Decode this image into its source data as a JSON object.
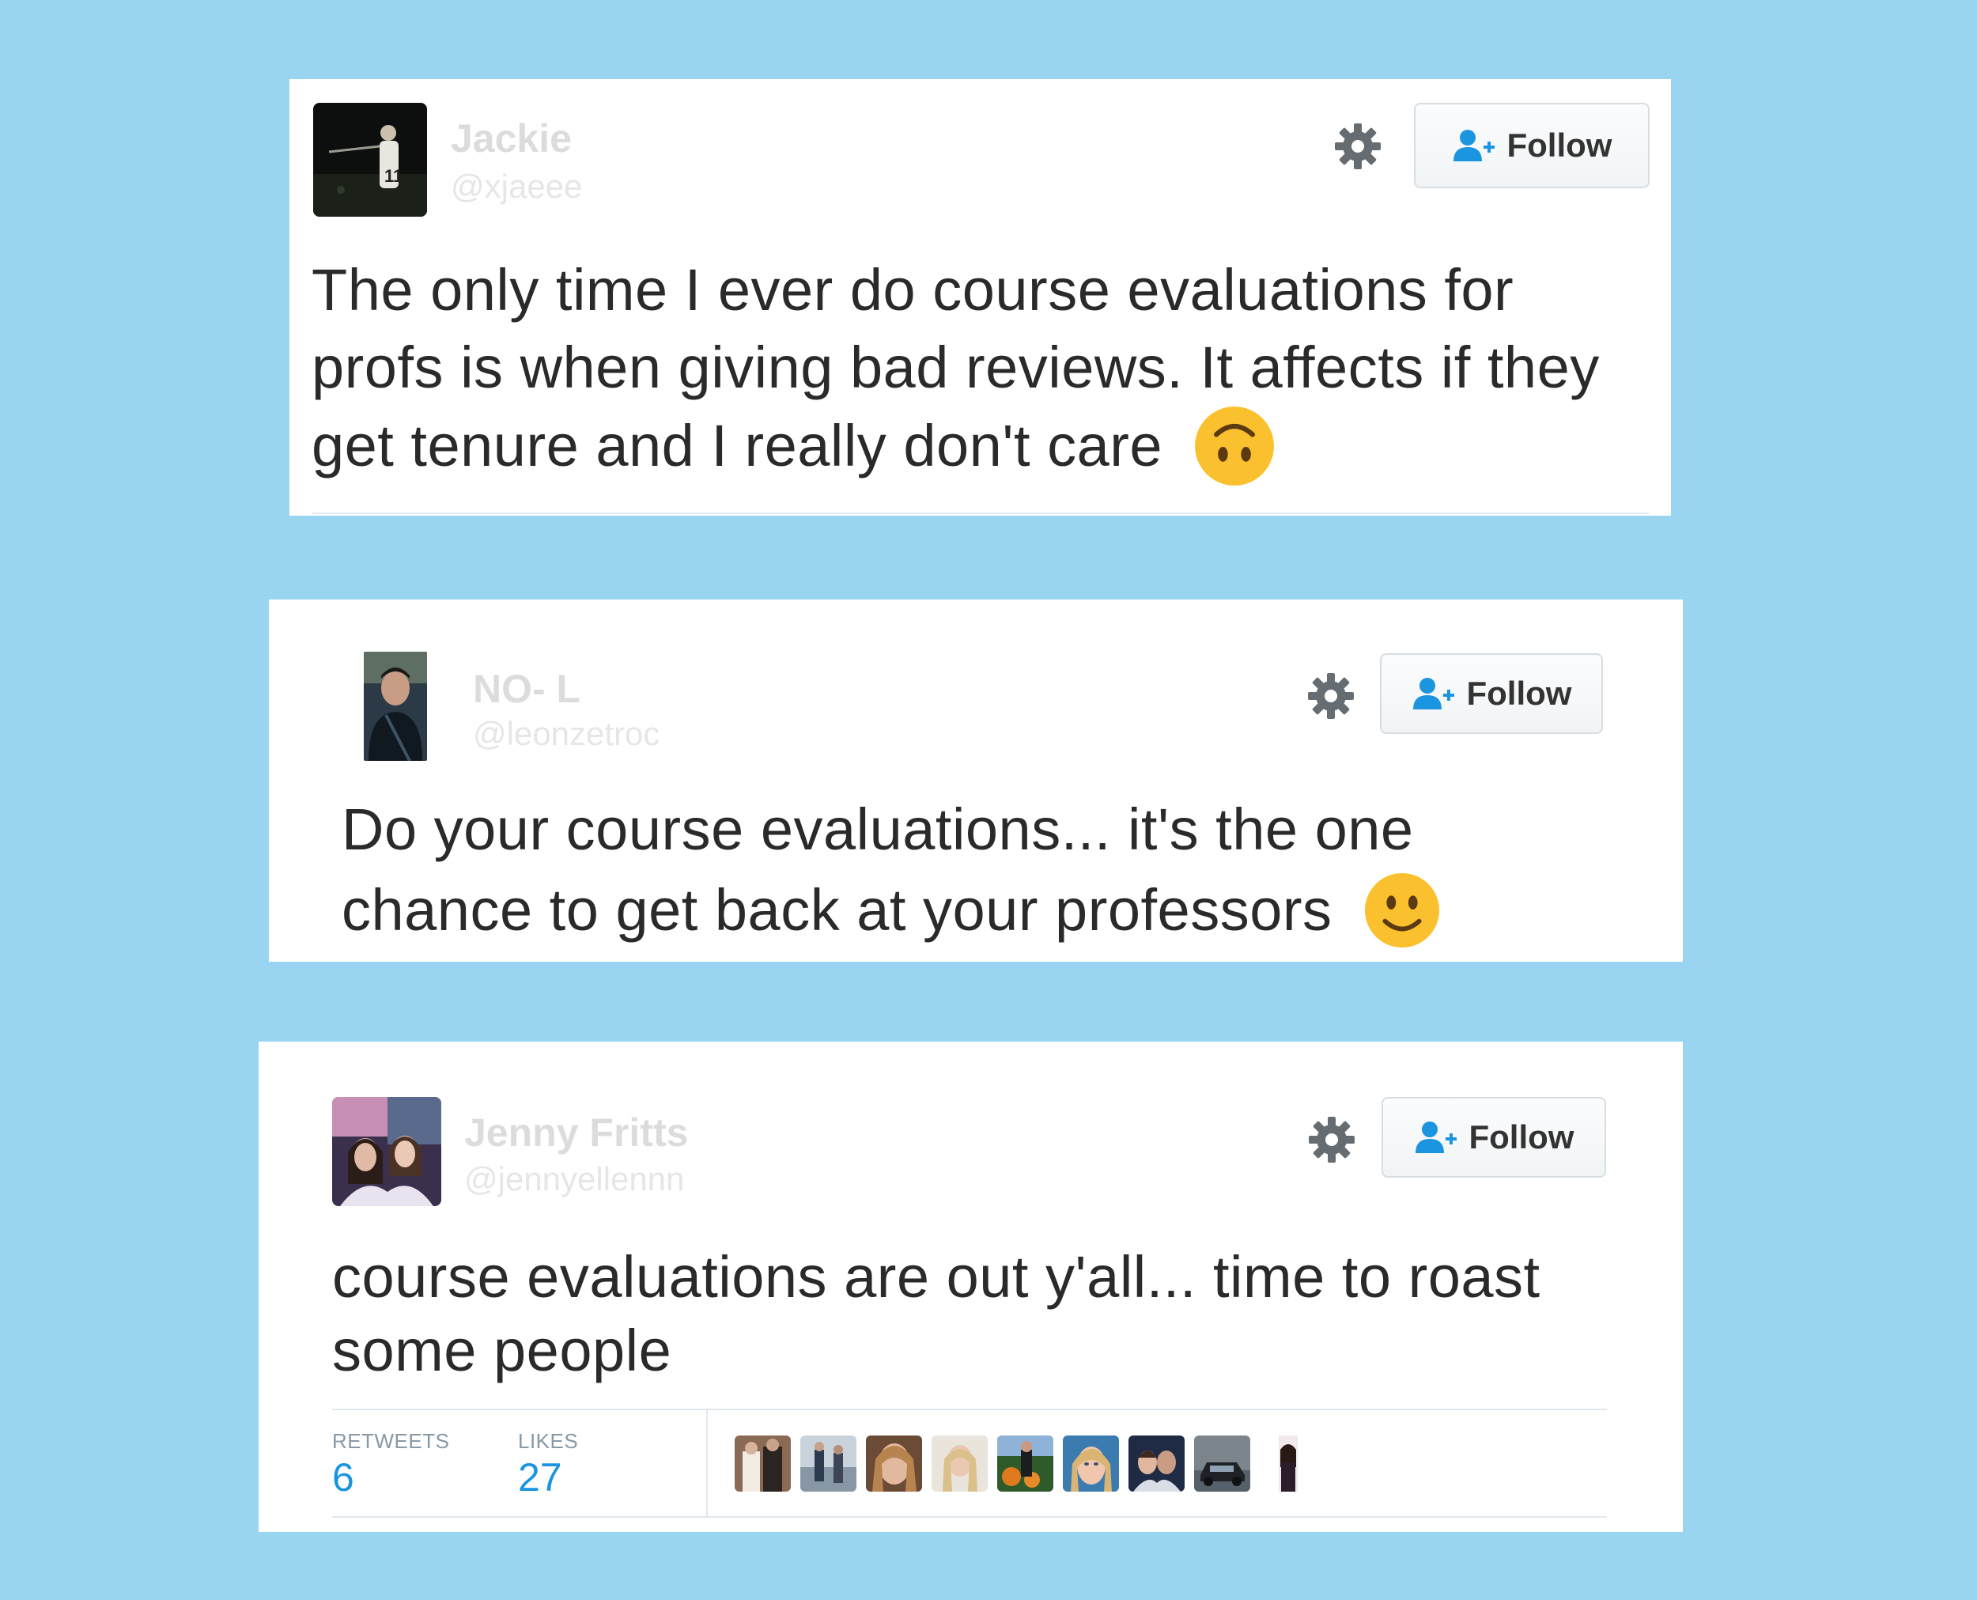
{
  "tweets": [
    {
      "name": "Jackie",
      "handle": "@xjaeee",
      "follow_label": "Follow",
      "text": "The only time I ever do course evaluations for profs is when giving bad reviews. It affects if they get tenure and I really don't care",
      "emoji": "upside-down-face"
    },
    {
      "name": "NO- L",
      "handle": "@leonzetroc",
      "follow_label": "Follow",
      "text": "Do your course evaluations... it's the one chance to get back at your professors",
      "emoji": "slightly-smiling-face"
    },
    {
      "name": "Jenny Fritts",
      "handle": "@jennyellennn",
      "follow_label": "Follow",
      "text": "course evaluations are out y'all... time to roast some people",
      "stats": {
        "retweets_label": "RETWEETS",
        "retweets_value": "6",
        "likes_label": "LIKES",
        "likes_value": "27"
      }
    }
  ],
  "icons": {
    "settings": "gear-icon",
    "follow": "add-user-icon"
  },
  "colors": {
    "page_background": "#99d5f1",
    "card_background": "#ffffff",
    "name_text": "#dcdcdc",
    "body_text": "#2a2a2a",
    "link_blue": "#1b95e0",
    "emoji_yellow": "#fbc02d"
  }
}
